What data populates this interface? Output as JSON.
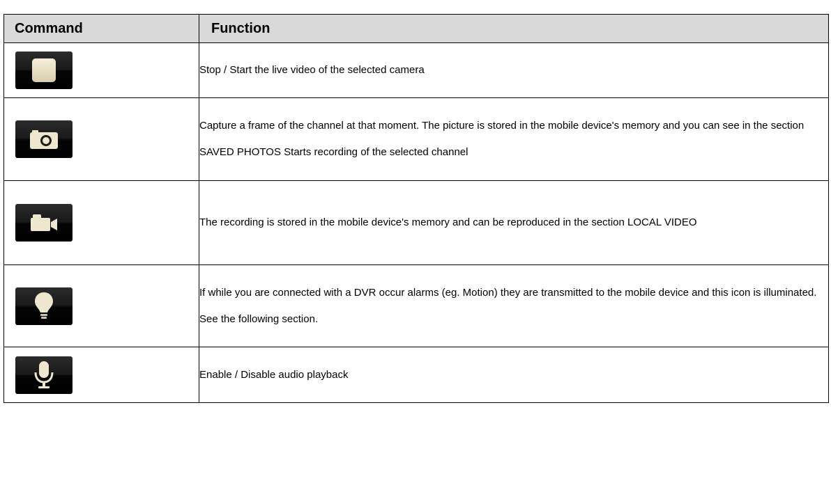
{
  "table": {
    "headers": {
      "command": "Command",
      "function": "Function"
    },
    "rows": [
      {
        "icon": "stop-icon",
        "function": "Stop / Start the live video of the selected camera"
      },
      {
        "icon": "camera-icon",
        "function": "Capture a frame of the channel at that moment. The picture is stored in the mobile device's memory and you can see in the section SAVED PHOTOS Starts recording of the selected channel"
      },
      {
        "icon": "video-camera-icon",
        "function": "The recording is stored in the mobile device's memory and can be reproduced in the section LOCAL VIDEO"
      },
      {
        "icon": "light-bulb-icon",
        "function": "If while you are connected with a DVR occur alarms (eg. Motion) they are transmitted to the mobile device and this icon is illuminated. See the following section."
      },
      {
        "icon": "microphone-icon",
        "function": "Enable / Disable audio playback"
      }
    ]
  },
  "colors": {
    "header_background": "#d9d9d9",
    "icon_background": "#1a1a1a",
    "icon_glyph": "#efe6cf"
  }
}
